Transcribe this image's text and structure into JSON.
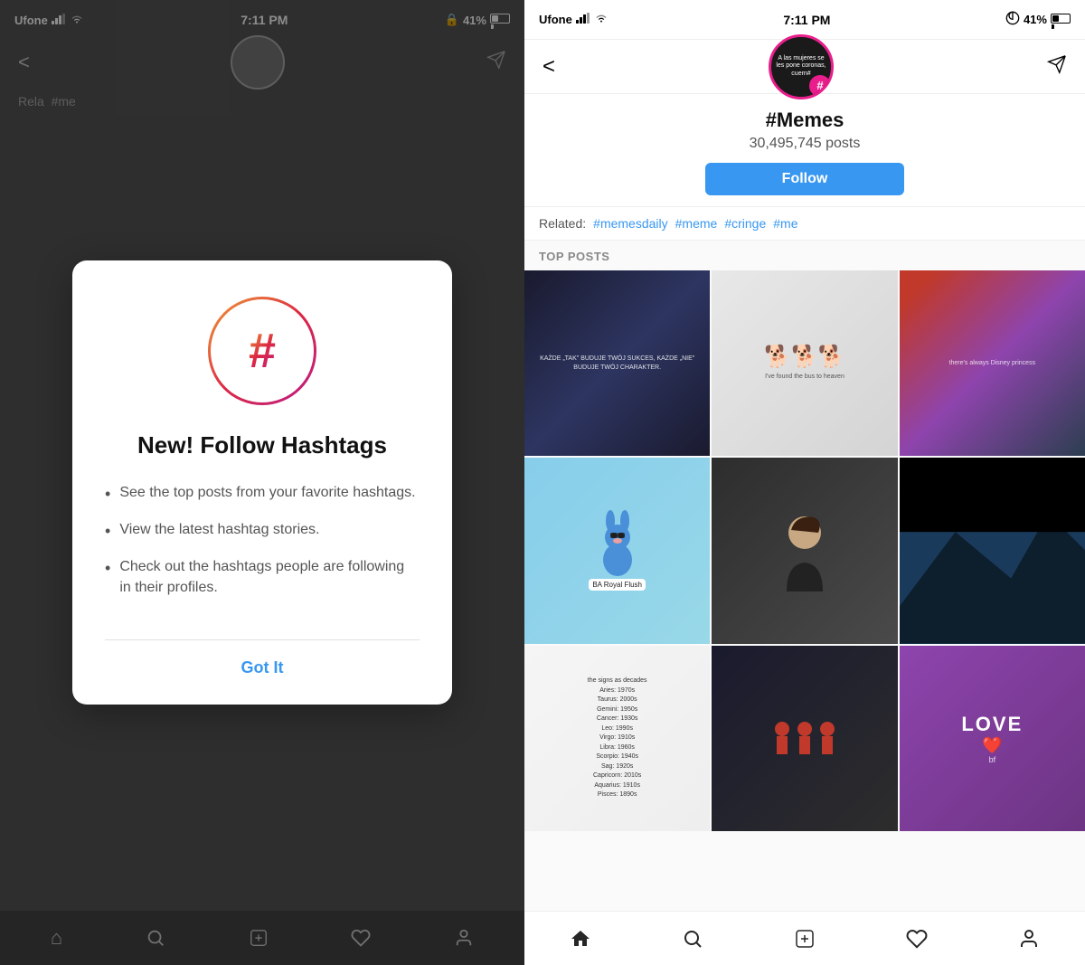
{
  "left": {
    "status": {
      "carrier": "Ufone",
      "wifi": "WiFi",
      "time": "7:11 PM",
      "battery": "41%"
    },
    "modal": {
      "title": "New! Follow Hashtags",
      "features": [
        "See the top posts from your favorite hashtags.",
        "View the latest hashtag stories.",
        "Check out the hashtags people are following in their profiles."
      ],
      "got_it_label": "Got It"
    },
    "related_partial": "Rela"
  },
  "right": {
    "status": {
      "carrier": "Ufone",
      "wifi": "WiFi",
      "time": "7:11 PM",
      "battery": "41%"
    },
    "profile": {
      "name": "#Memes",
      "posts_count": "30,495,745 posts",
      "follow_label": "Follow"
    },
    "related": {
      "label": "Related:",
      "tags": [
        "#memesdaily",
        "#meme",
        "#cringe",
        "#me"
      ]
    },
    "top_posts_header": "TOP POSTS",
    "posts": [
      {
        "id": 1,
        "type": "dark-text",
        "caption": "KAŻDE TAK BUDUJE TWÓJ SUKCES, KAŻDE NIE BUDUJE TWÓJ CHARAKTER."
      },
      {
        "id": 2,
        "type": "dogs",
        "caption": "I've found the bus to heaven"
      },
      {
        "id": 3,
        "type": "book",
        "caption": ""
      },
      {
        "id": 4,
        "type": "cartoon",
        "caption": "BA Royal Flush"
      },
      {
        "id": 5,
        "type": "selfie",
        "caption": ""
      },
      {
        "id": 6,
        "type": "landscape",
        "caption": ""
      },
      {
        "id": 7,
        "type": "signs",
        "caption": "the signs as decades"
      },
      {
        "id": 8,
        "type": "team",
        "caption": ""
      },
      {
        "id": 9,
        "type": "love",
        "caption": "LOVE"
      }
    ],
    "bottom_nav": {
      "home_active": true,
      "items": [
        "home",
        "search",
        "add",
        "heart",
        "profile"
      ]
    }
  }
}
